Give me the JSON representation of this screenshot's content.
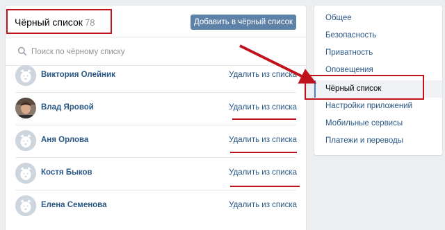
{
  "header": {
    "title": "Чёрный список",
    "count": "78",
    "add_button": "Добавить в чёрный список"
  },
  "search": {
    "placeholder": "Поиск по чёрному списку"
  },
  "list": [
    {
      "name": "Виктория Олейник",
      "action": "Удалить из списка",
      "avatar": "default-dog-avatar"
    },
    {
      "name": "Влад Яровой",
      "action": "Удалить из списка",
      "avatar": "user-photo-avatar"
    },
    {
      "name": "Аня Орлова",
      "action": "Удалить из списка",
      "avatar": "default-dog-avatar"
    },
    {
      "name": "Костя Быков",
      "action": "Удалить из списка",
      "avatar": "default-dog-avatar"
    },
    {
      "name": "Елена Семенова",
      "action": "Удалить из списка",
      "avatar": "default-dog-avatar"
    }
  ],
  "menu": {
    "items": [
      {
        "label": "Общее"
      },
      {
        "label": "Безопасность"
      },
      {
        "label": "Приватность"
      },
      {
        "label": "Оповещения"
      },
      {
        "label": "Чёрный список",
        "active": true
      },
      {
        "label": "Настройки приложений"
      },
      {
        "label": "Мобильные сервисы"
      },
      {
        "label": "Платежи и переводы"
      }
    ]
  },
  "colors": {
    "accent": "#5e81a8",
    "link": "#2a5885",
    "annotation_red": "#c0121c",
    "background": "#edeef0"
  }
}
